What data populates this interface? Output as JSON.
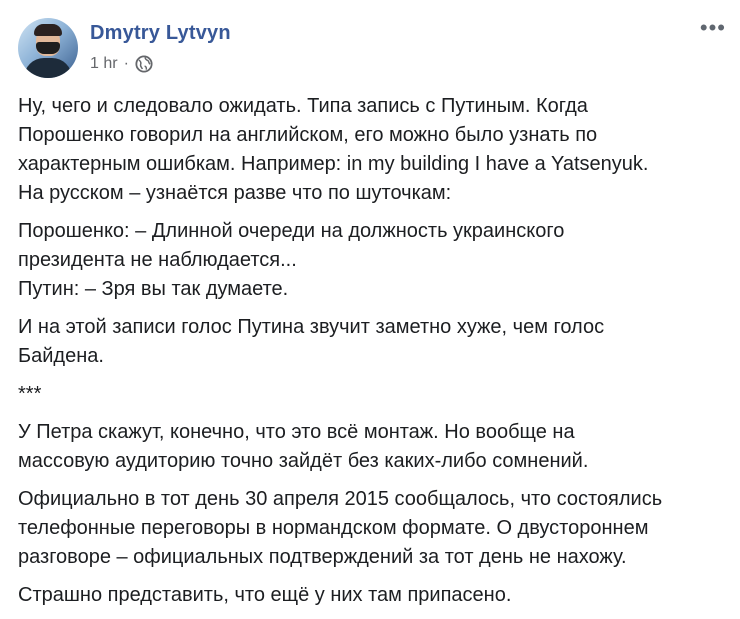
{
  "author": {
    "name": "Dmytry Lytvyn",
    "time": "1 hr",
    "separator": "·",
    "privacy_icon": "globe-icon",
    "avatar_desc": "avatar"
  },
  "menu": {
    "more_label": "•••",
    "icon": "more-options-icon"
  },
  "post": {
    "paragraphs": [
      "Ну, чего и следовало ожидать. Типа запись с Путиным. Когда\nПорошенко говорил на английском, его можно было узнать по\nхарактерным ошибкам. Например: in my building I have a Yatsenyuk.\nНа русском – узнаётся разве что по шуточкам:",
      "Порошенко: – Длинной очереди на должность украинского\nпрезидента не наблюдается...\nПутин: – Зря вы так думаете.",
      "И на этой записи голос Путина звучит заметно хуже, чем голос\nБайдена.",
      "***",
      "У Петра скажут, конечно, что это всё монтаж. Но вообще на\nмассовую аудиторию точно зайдёт без каких-либо сомнений.",
      "Официально в тот день 30 апреля 2015 сообщалось, что состоялись\nтелефонные переговоры в нормандском формате. О двустороннем\nразговоре – официальных подтверждений за тот день не нахожу.",
      "Страшно представить, что ещё у них там припасено."
    ]
  },
  "colors": {
    "name": "#385898",
    "text": "#1c1e21",
    "meta": "#65676b"
  }
}
